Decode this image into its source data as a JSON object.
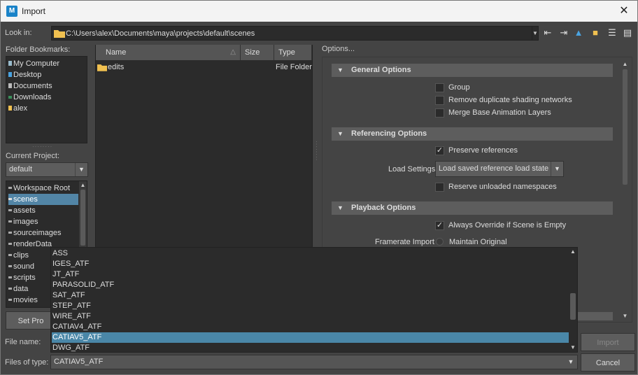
{
  "window": {
    "title": "Import",
    "app_icon": "M"
  },
  "look_in": {
    "label": "Look in:",
    "path": "C:\\Users\\alex\\Documents\\maya\\projects\\default\\scenes"
  },
  "bookmarks": {
    "label": "Folder Bookmarks:",
    "items": [
      {
        "label": "My Computer",
        "icon": "computer-icon"
      },
      {
        "label": "Desktop",
        "icon": "desktop-icon"
      },
      {
        "label": "Documents",
        "icon": "documents-icon"
      },
      {
        "label": "Downloads",
        "icon": "downloads-icon"
      },
      {
        "label": "alex",
        "icon": "folder-icon"
      }
    ]
  },
  "project": {
    "label": "Current Project:",
    "value": "default",
    "items": [
      "Workspace Root",
      "scenes",
      "assets",
      "images",
      "sourceimages",
      "renderData",
      "clips",
      "sound",
      "scripts",
      "data",
      "movies"
    ],
    "selected": "scenes",
    "set_button": "Set Pro"
  },
  "files": {
    "columns": [
      "Name",
      "Size",
      "Type"
    ],
    "rows": [
      {
        "name": "edits",
        "size": "",
        "type": "File Folder"
      }
    ]
  },
  "options": {
    "label": "Options...",
    "general": {
      "title": "General Options",
      "group": "Group",
      "remove_dup": "Remove duplicate shading networks",
      "merge_base": "Merge Base Animation Layers"
    },
    "referencing": {
      "title": "Referencing Options",
      "preserve": "Preserve references",
      "load_settings_label": "Load Settings",
      "load_settings_value": "Load saved reference load state",
      "reserve": "Reserve unloaded namespaces"
    },
    "playback": {
      "title": "Playback Options",
      "always_override": "Always Override if Scene is Empty",
      "framerate_label": "Framerate Import",
      "maintain": "Maintain Original"
    }
  },
  "file_name": {
    "label": "File name:",
    "value": ""
  },
  "files_of_type": {
    "label": "Files of type:",
    "value": "CATIAV5_ATF",
    "options": [
      "ASS",
      "IGES_ATF",
      "JT_ATF",
      "PARASOLID_ATF",
      "SAT_ATF",
      "STEP_ATF",
      "WIRE_ATF",
      "CATIAV4_ATF",
      "CATIAV5_ATF",
      "DWG_ATF"
    ],
    "selected": "CATIAV5_ATF"
  },
  "buttons": {
    "import": "Import",
    "cancel": "Cancel"
  },
  "colors": {
    "background": "#444444",
    "panel": "#2b2b2b",
    "selection": "#4a87a8",
    "folder": "#f0c050"
  }
}
